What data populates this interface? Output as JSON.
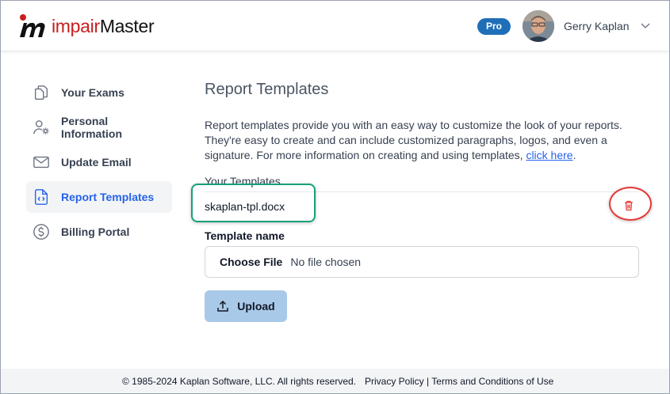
{
  "brand": {
    "name_part1": "impair",
    "name_part2": "Master",
    "accent": "#c81e1e"
  },
  "header": {
    "badge": "Pro",
    "user_name": "Gerry Kaplan"
  },
  "sidebar": {
    "items": [
      {
        "label": "Your Exams",
        "icon": "documents-icon"
      },
      {
        "label": "Personal Information",
        "icon": "user-settings-icon"
      },
      {
        "label": "Update Email",
        "icon": "envelope-icon"
      },
      {
        "label": "Report Templates",
        "icon": "file-code-icon",
        "active": true
      },
      {
        "label": "Billing Portal",
        "icon": "dollar-circle-icon"
      }
    ]
  },
  "main": {
    "title": "Report Templates",
    "description": "Report templates provide you with an easy way to customize the look of your reports. They're easy to create and can include customized paragraphs, logos, and even a signature. For more information on creating and using templates, ",
    "description_link": "click here",
    "description_end": ".",
    "templates_label": "Your Templates",
    "templates": [
      {
        "name": "skaplan-tpl.docx"
      }
    ],
    "template_name_label": "Template name",
    "file_input": {
      "button": "Choose File",
      "status": "No file chosen"
    },
    "upload_label": "Upload"
  },
  "footer": {
    "copyright": "© 1985-2024 Kaplan Software, LLC. All rights reserved.",
    "privacy": "Privacy Policy",
    "separator": "|",
    "terms": "Terms and Conditions of Use"
  },
  "colors": {
    "active_nav": "#2563eb",
    "pro_badge": "#1f6fb8",
    "upload_button": "#a9c9e8",
    "highlight_green": "#17a07a",
    "highlight_red": "#e53935"
  }
}
